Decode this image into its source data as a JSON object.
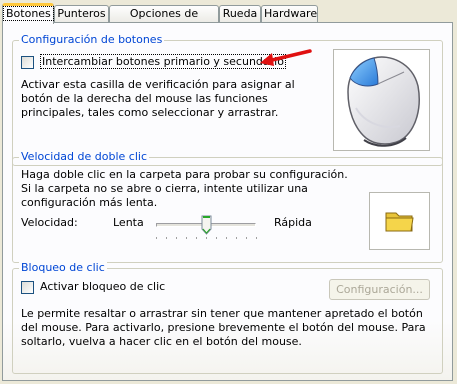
{
  "tabs": [
    {
      "label": "Botones",
      "active": true
    },
    {
      "label": "Punteros",
      "active": false
    },
    {
      "label": "Opciones de puntero",
      "active": false
    },
    {
      "label": "Rueda",
      "active": false
    },
    {
      "label": "Hardware",
      "active": false
    }
  ],
  "button_config": {
    "legend": "Configuración de botones",
    "checkbox_label": "Intercambiar botones primario y secundario",
    "checked": false,
    "description": "Activar esta casilla de verificación para asignar al botón de la derecha del mouse las funciones principales, tales como seleccionar y arrastrar.",
    "image_icon": "mouse-icon"
  },
  "double_click": {
    "legend": "Velocidad de doble clic",
    "description": "Haga doble clic en la carpeta para probar su configuración. Si la carpeta no se abre o cierra, intente utilizar una configuración más lenta.",
    "speed_label": "Velocidad:",
    "slow_label": "Lenta",
    "fast_label": "Rápida",
    "slider_value": 0.5,
    "image_icon": "folder-icon"
  },
  "click_lock": {
    "legend": "Bloqueo de clic",
    "checkbox_label": "Activar bloqueo de clic",
    "checked": false,
    "settings_button": "Configuración...",
    "description": "Le permite resaltar o arrastrar sin tener que mantener apretado el botón del mouse. Para activarlo, presione brevemente el botón del mouse. Para soltarlo, vuelva a hacer clic en el botón del mouse."
  },
  "colors": {
    "legend": "#0046d5",
    "arrow": "#e01010",
    "tab_highlight": "#ffc83c",
    "folder": "#f5d54a"
  }
}
